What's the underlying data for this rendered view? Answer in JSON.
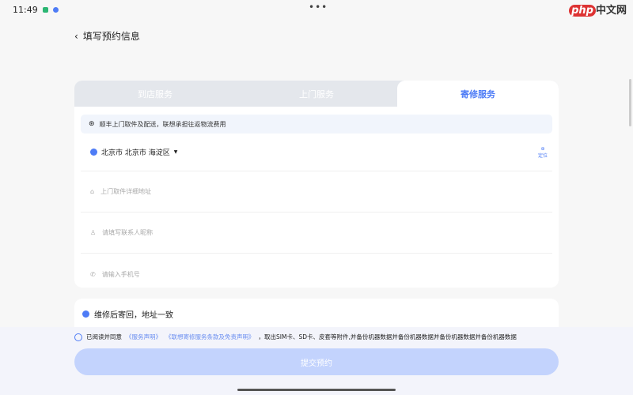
{
  "status": {
    "time": "11:49"
  },
  "watermark": "php中文网",
  "header": {
    "back_icon": "chevron-left",
    "title": "填写预约信息"
  },
  "tabs": [
    {
      "label": "到店服务"
    },
    {
      "label": "上门服务"
    },
    {
      "label": "寄修服务",
      "active": true
    }
  ],
  "notice": {
    "icon": "sf-express-icon",
    "text": "顺丰上门取件及配送，联想承担往返物流费用"
  },
  "region": {
    "value": "北京市 北京市 海淀区",
    "locate_label": "定位"
  },
  "fields": [
    {
      "icon": "home-icon",
      "placeholder": "上门取件详细地址"
    },
    {
      "icon": "user-icon",
      "placeholder": "请填写联系人昵称"
    },
    {
      "icon": "phone-icon",
      "placeholder": "请输入手机号"
    }
  ],
  "return_option": {
    "label": "维修后寄回，地址一致"
  },
  "agreement": {
    "prefix": "已阅读并同意",
    "link1": "《服务声明》",
    "link2": "《联想寄修服务条款及免责声明》",
    "suffix": "，取出SIM卡、SD卡、皮套等附件,并备份机器数据并备份机器数据并备份机器数据并备份机器数据"
  },
  "submit_label": "提交预约",
  "colors": {
    "accent": "#4e7cf6",
    "submit_disabled": "#c3d3fd"
  }
}
